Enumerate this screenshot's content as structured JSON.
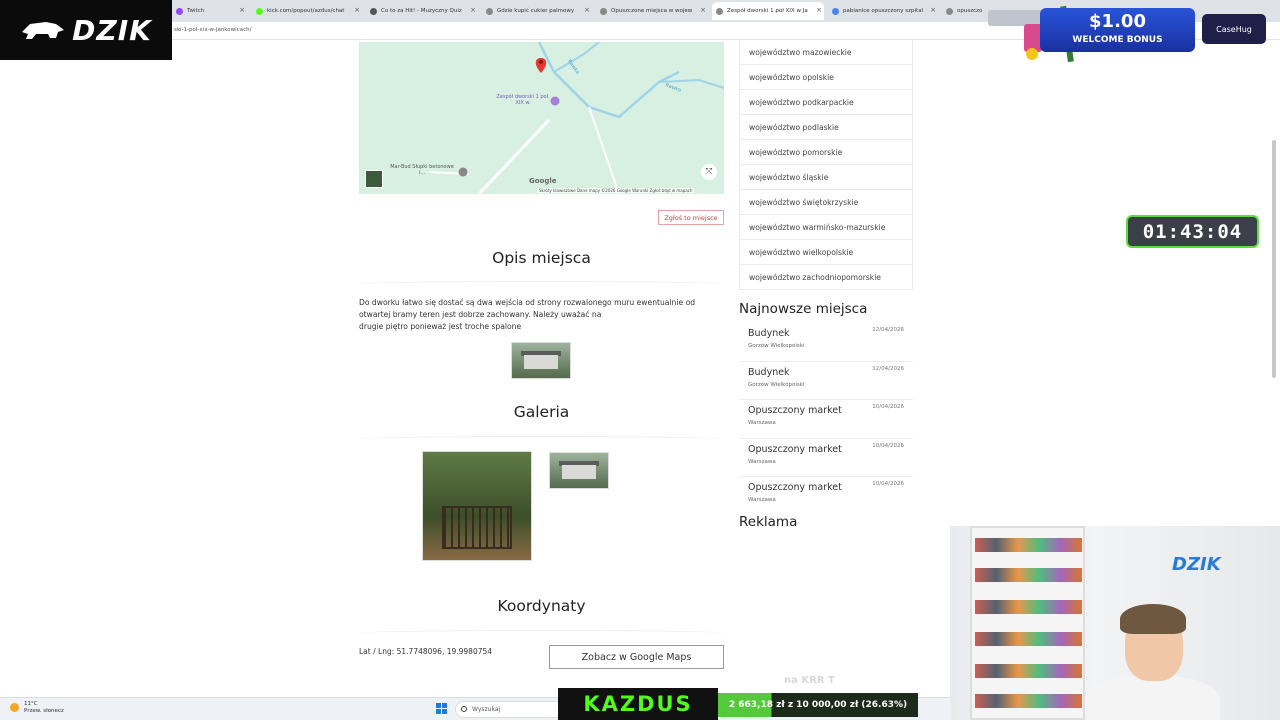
{
  "browser": {
    "tabs": [
      {
        "label": "Twitch",
        "color": "#9146ff"
      },
      {
        "label": "kick.com/popout/azdus/chat",
        "color": "#53fc18"
      },
      {
        "label": "Co to za Hit! - Muzyczny Quiz",
        "color": "#555555"
      },
      {
        "label": "Gdzie kupić cukier palmowy",
        "color": "#888888"
      },
      {
        "label": "Opuszczone miejsca w wojew",
        "color": "#888888"
      },
      {
        "label": "Zespół dworski 1 poł XIX w Ja",
        "color": "#888888"
      },
      {
        "label": "pabianice opuszczony szpital",
        "color": "#4285f4"
      },
      {
        "label": "opuszczo",
        "color": "#888888"
      }
    ],
    "url": "ski-1-pol-xix-w-jankowicach/"
  },
  "logo": {
    "text": "DZIK"
  },
  "promo": {
    "amount": "$1.00",
    "subtitle": "WELCOME BONUS",
    "brand": "CaseHug"
  },
  "timer": {
    "value": "01:43:04"
  },
  "map": {
    "place_label": "Zespół dworski 1 poł. XIX w.",
    "road_1": "Rawka",
    "road_2": "Rawka",
    "business_label": "Mar-Bud Słupki betonowe i...",
    "google": "Google",
    "footer": "Skróty klawiszowe   Dane mapy ©2026 Google   Warunki   Zgłoś błąd w mapach"
  },
  "report_button": "Zgłoś to miejsce",
  "description": {
    "title": "Opis miejsca",
    "text_line1": "Do dworku łatwo się dostać są dwa wejścia od strony rozwalonego muru ewentualnie od",
    "text_line2": "otwartej bramy teren jest dobrze zachowany. Należy uważać na",
    "text_line3": "drugie piętro ponieważ jest troche spalone"
  },
  "gallery": {
    "title": "Galeria"
  },
  "coordinates": {
    "title": "Koordynaty",
    "text": "Lat / Lng: 51.7748096, 19.9980754",
    "button": "Zobacz w Google Maps"
  },
  "sidebar": {
    "regions": [
      "województwo mazowieckie",
      "województwo opolskie",
      "województwo podkarpackie",
      "województwo podlaskie",
      "województwo pomorskie",
      "województwo śląskie",
      "województwo świętokrzyskie",
      "województwo warmińsko-mazurskie",
      "województwo wielkopolskie",
      "województwo zachodniopomorskie"
    ],
    "newest_title": "Najnowsze miejsca",
    "newest": [
      {
        "name": "Budynek",
        "city": "Gorzów Wielkopolski",
        "date": "12/04/2026"
      },
      {
        "name": "Budynek",
        "city": "Gorzów Wielkopolski",
        "date": "12/04/2026"
      },
      {
        "name": "Opuszczony market",
        "city": "Warszawa",
        "date": "10/04/2026"
      },
      {
        "name": "Opuszczony market",
        "city": "Warszawa",
        "date": "10/04/2026"
      },
      {
        "name": "Opuszczony market",
        "city": "Warszawa",
        "date": "10/04/2026"
      }
    ],
    "ads_title": "Reklama"
  },
  "webcam": {
    "logo": "DZIK"
  },
  "taskbar": {
    "weather_temp": "11°C",
    "weather_desc": "Przew. słonecz",
    "search": "Wyszukaj"
  },
  "stream": {
    "name": "KAZDUS",
    "goal": "2 663,18 zł z 10 000,00 zł (26.63%)",
    "goal_progress": 0.2663,
    "faint_text": "na KRR T"
  }
}
